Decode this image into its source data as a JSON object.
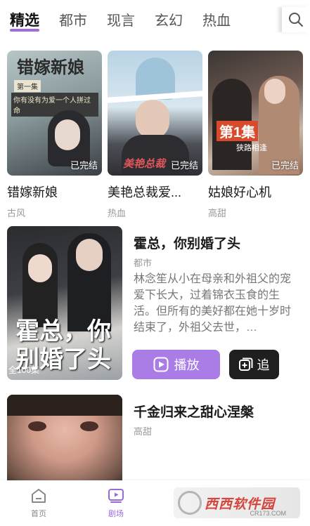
{
  "tabs": [
    "精选",
    "都市",
    "现言",
    "玄幻",
    "热血"
  ],
  "active_tab": "精选",
  "grid": [
    {
      "title": "错嫁新娘",
      "genre": "古风",
      "status": "已完结",
      "cover_text": "错嫁新娘",
      "cover_line1": "第一集",
      "cover_line2": "你有没有为爱一个人拼过命"
    },
    {
      "title": "美艳总裁爱...",
      "genre": "热血",
      "status": "已完结",
      "cover_text": "美艳总裁"
    },
    {
      "title": "姑娘好心机",
      "genre": "高甜",
      "status": "已完结",
      "cover_text": "第1集",
      "cover_sub": "狭路相逢"
    }
  ],
  "featured": {
    "title": "霍总，你别婚了头",
    "genre": "都市",
    "description": "林念笙从小在母亲和外祖父的宠爱下长大，过着锦衣玉食的生活。但所有的美好都在她十岁时结束了，外祖父去世，…",
    "cover_text": "霍总，你别婚了头",
    "episodes": "全100集",
    "play_label": "播放",
    "follow_label": "追"
  },
  "featured2": {
    "title": "千金归来之甜心涅槃",
    "genre": "高甜"
  },
  "bottom_nav": {
    "home": "首页",
    "theater": "剧场"
  },
  "watermark": {
    "name": "西西软件园",
    "url": "CR173.COM"
  },
  "colors": {
    "accent": "#a97ce6",
    "dark_button": "#1f1f1f"
  }
}
